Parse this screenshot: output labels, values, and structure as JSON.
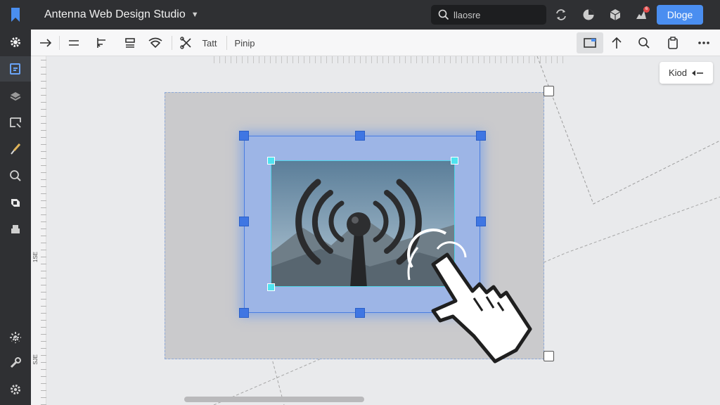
{
  "app": {
    "title": "Antenna Web Design Studio",
    "logo_icon": "bookmark-logo-icon"
  },
  "search": {
    "placeholder": "llaosre"
  },
  "header_actions": {
    "primary_button_label": "Dloge",
    "notification_count": "6"
  },
  "toolbar": {
    "text_label": "Tatt",
    "pip_label": "Pinip"
  },
  "canvas": {
    "kind_chip_label": "Kiod",
    "ruler_labels": [
      "1SE",
      "SJE"
    ]
  },
  "colors": {
    "chrome": "#2f3033",
    "accent": "#4a8ef0",
    "selection": "#4a7de0",
    "inner_selection": "#4fd5e8"
  }
}
